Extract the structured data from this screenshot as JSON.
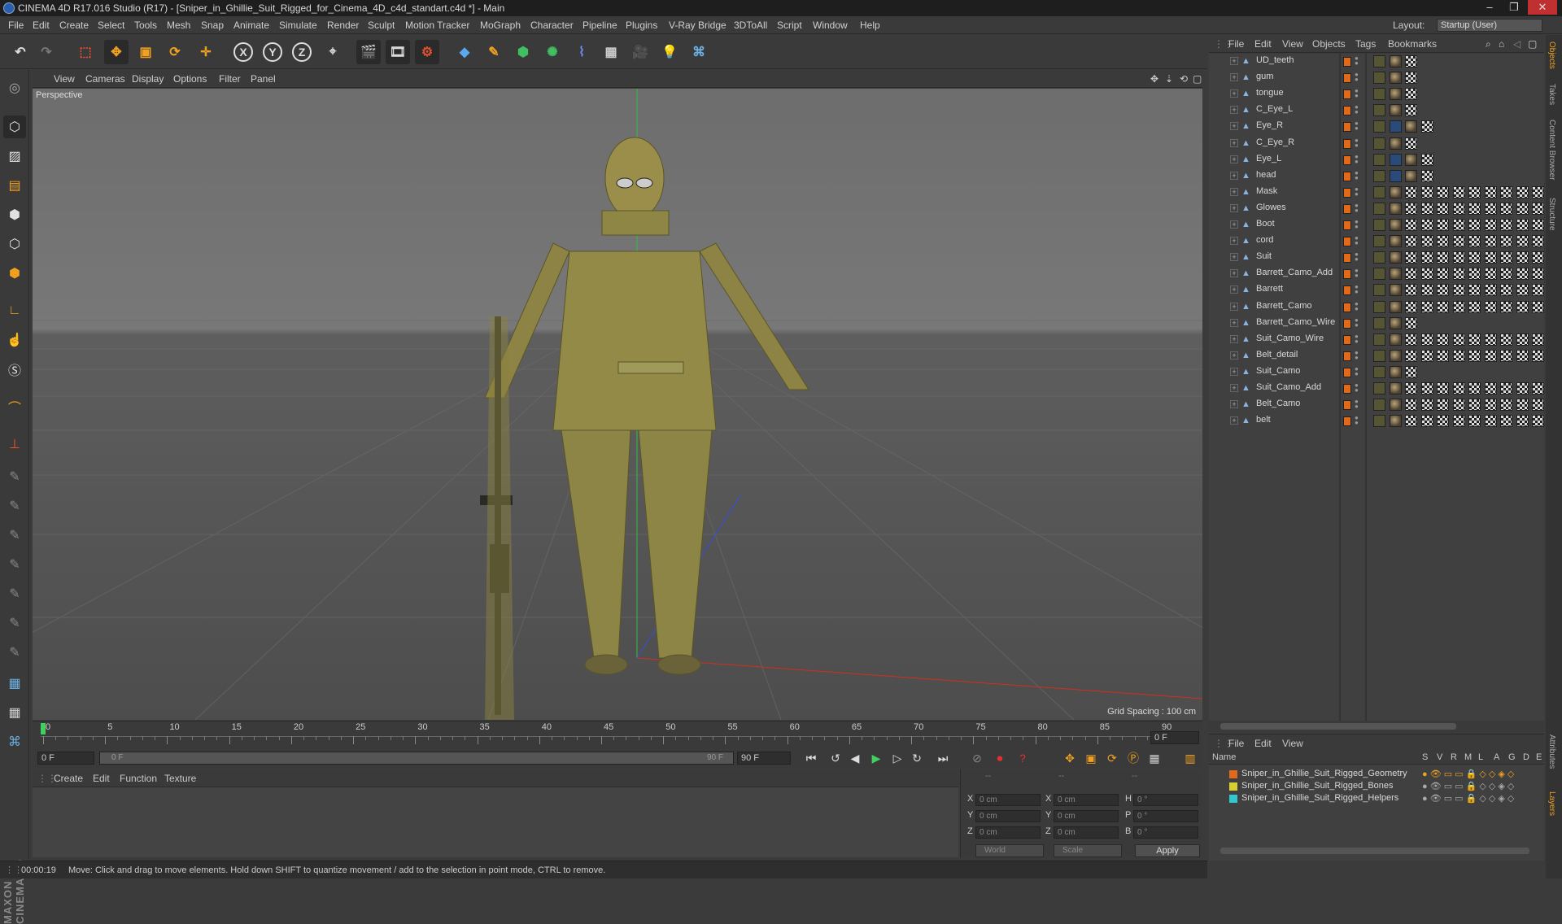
{
  "window": {
    "title": "CINEMA 4D R17.016 Studio (R17) - [Sniper_in_Ghillie_Suit_Rigged_for_Cinema_4D_c4d_standart.c4d *] - Main"
  },
  "menu": [
    "File",
    "Edit",
    "Create",
    "Select",
    "Tools",
    "Mesh",
    "Snap",
    "Animate",
    "Simulate",
    "Render",
    "Sculpt",
    "Motion Tracker",
    "MoGraph",
    "Character",
    "Pipeline",
    "Plugins",
    "V-Ray Bridge",
    "3DToAll",
    "Script",
    "Window",
    "Help"
  ],
  "layout": {
    "label": "Layout:",
    "value": "Startup (User)"
  },
  "toolbar": {
    "x": "X",
    "y": "Y",
    "z": "Z"
  },
  "viewport": {
    "menu": [
      "View",
      "Cameras",
      "Display",
      "Options",
      "Filter",
      "Panel"
    ],
    "label": "Perspective",
    "grid_spacing": "Grid Spacing : 100 cm"
  },
  "timeline": {
    "ticks": [
      "0",
      "5",
      "10",
      "15",
      "20",
      "25",
      "30",
      "35",
      "40",
      "45",
      "50",
      "55",
      "60",
      "65",
      "70",
      "75",
      "80",
      "85",
      "90"
    ],
    "current_frame": "0 F",
    "start": "0 F",
    "range_start": "0 F",
    "range_end": "90 F",
    "end": "90 F"
  },
  "material_menu": [
    "Create",
    "Edit",
    "Function",
    "Texture"
  ],
  "coords": {
    "x_pos": "0 cm",
    "y_pos": "0 cm",
    "z_pos": "0 cm",
    "x_size": "0 cm",
    "y_size": "0 cm",
    "z_size": "0 cm",
    "h": "0 °",
    "p": "0 °",
    "b": "0 °",
    "labels": {
      "x": "X",
      "y": "Y",
      "z": "Z",
      "h": "H",
      "p": "P",
      "b": "B"
    },
    "world": "World",
    "scale": "Scale",
    "apply": "Apply",
    "dash1": "--",
    "dash2": "--",
    "dash3": "--"
  },
  "status": {
    "time": "00:00:19",
    "message": "Move: Click and drag to move elements. Hold down SHIFT to quantize movement / add to the selection in point mode, CTRL to remove."
  },
  "object_menu": [
    "File",
    "Edit",
    "View",
    "Objects",
    "Tags",
    "Bookmarks"
  ],
  "objects": [
    {
      "name": "UD_teeth",
      "tags": "std"
    },
    {
      "name": "gum",
      "tags": "std"
    },
    {
      "name": "tongue",
      "tags": "std"
    },
    {
      "name": "C_Eye_L",
      "tags": "std"
    },
    {
      "name": "Eye_R",
      "tags": "eye"
    },
    {
      "name": "C_Eye_R",
      "tags": "std"
    },
    {
      "name": "Eye_L",
      "tags": "eye"
    },
    {
      "name": "head",
      "tags": "eye"
    },
    {
      "name": "Mask",
      "tags": "full"
    },
    {
      "name": "Glowes",
      "tags": "full"
    },
    {
      "name": "Boot",
      "tags": "full"
    },
    {
      "name": "cord",
      "tags": "full"
    },
    {
      "name": "Suit",
      "tags": "full"
    },
    {
      "name": "Barrett_Camo_Add",
      "tags": "full"
    },
    {
      "name": "Barrett",
      "tags": "full"
    },
    {
      "name": "Barrett_Camo",
      "tags": "full"
    },
    {
      "name": "Barrett_Camo_Wire",
      "tags": "std"
    },
    {
      "name": "Suit_Camo_Wire",
      "tags": "full"
    },
    {
      "name": "Belt_detail",
      "tags": "full"
    },
    {
      "name": "Suit_Camo",
      "tags": "std"
    },
    {
      "name": "Suit_Camo_Add",
      "tags": "full"
    },
    {
      "name": "Belt_Camo",
      "tags": "full"
    },
    {
      "name": "belt",
      "tags": "full"
    }
  ],
  "layer_menu": [
    "File",
    "Edit",
    "View"
  ],
  "layer_header": {
    "name": "Name",
    "cols": [
      "S",
      "V",
      "R",
      "M",
      "L",
      "A",
      "G",
      "D",
      "E"
    ]
  },
  "layers": [
    {
      "name": "Sniper_in_Ghillie_Suit_Rigged_Geometry",
      "color": "#e06a1a"
    },
    {
      "name": "Sniper_in_Ghillie_Suit_Rigged_Bones",
      "color": "#d8d030"
    },
    {
      "name": "Sniper_in_Ghillie_Suit_Rigged_Helpers",
      "color": "#30c8d0"
    }
  ],
  "right_tabs": [
    "Objects",
    "Takes",
    "Content Browser",
    "Structure",
    "Attributes",
    "Layers"
  ],
  "brand": "MAXON CINEMA 4D"
}
